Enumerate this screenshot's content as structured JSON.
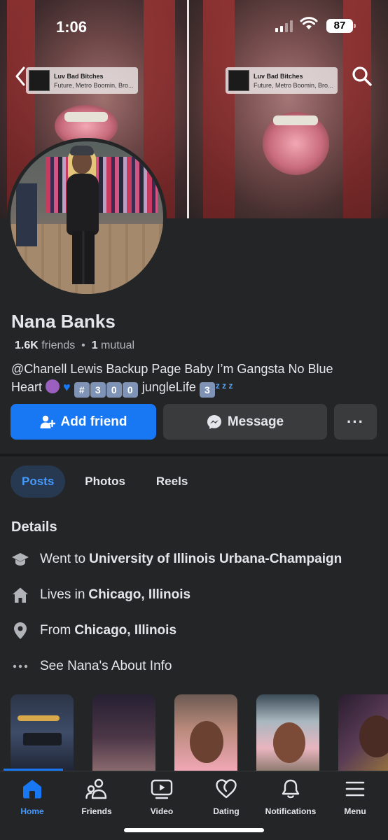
{
  "status_bar": {
    "time": "1:06",
    "battery": "87"
  },
  "cover": {
    "music_tags": [
      {
        "title": "Luv Bad Bitches",
        "artists": "Future, Metro Boomin, Bro..."
      },
      {
        "title": "Luv Bad Bitches",
        "artists": "Future, Metro Boomin, Bro..."
      }
    ]
  },
  "profile": {
    "name": "Nana Banks",
    "friends_count": "1.6K",
    "friends_label": "friends",
    "mutual_count": "1",
    "mutual_label": "mutual",
    "bio_line1": "@Chanell Lewis Backup Page Baby I’m Gangsta No Blue",
    "bio_line2_prefix": "Heart",
    "bio_keycaps": [
      "#",
      "3",
      "0",
      "0"
    ],
    "bio_line2_word": "jungleLife",
    "bio_keycap_end": "3",
    "bio_zzz": "z z z"
  },
  "actions": {
    "add_friend": "Add friend",
    "message": "Message",
    "more": "···"
  },
  "tabs": [
    {
      "label": "Posts",
      "active": true
    },
    {
      "label": "Photos",
      "active": false
    },
    {
      "label": "Reels",
      "active": false
    }
  ],
  "details": {
    "title": "Details",
    "education_prefix": "Went to",
    "education_value": "University of Illinois Urbana-Champaign",
    "lives_prefix": "Lives in",
    "lives_value": "Chicago, Illinois",
    "from_prefix": "From",
    "from_value": "Chicago, Illinois",
    "about_link": "See Nana's About Info"
  },
  "nav": {
    "home": "Home",
    "friends": "Friends",
    "video": "Video",
    "dating": "Dating",
    "notifications": "Notifications",
    "menu": "Menu"
  },
  "colors": {
    "accent": "#1877f2",
    "active_tab_text": "#4599ff",
    "background": "#242526",
    "button_secondary": "#3a3b3c"
  }
}
